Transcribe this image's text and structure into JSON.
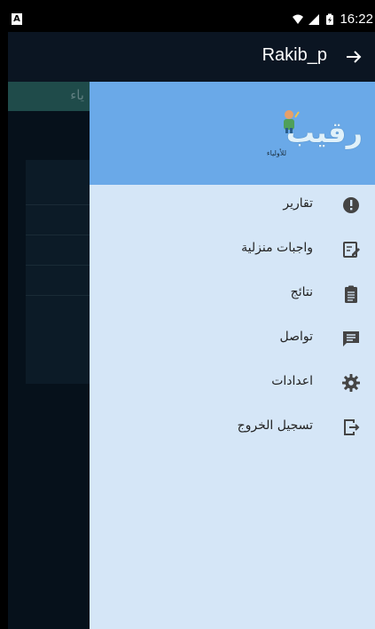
{
  "status_bar": {
    "left_badge": "A",
    "time": "16:22"
  },
  "app_bar": {
    "title": "Rakib_p",
    "arrow_icon": "arrow-right-icon"
  },
  "background_screen": {
    "header_text": "ياء"
  },
  "drawer": {
    "logo": {
      "text": "رقيب",
      "subtitle": "للأولياء"
    },
    "items": [
      {
        "label": "تقارير",
        "icon": "alert-circle-icon"
      },
      {
        "label": "واجبات منزلية",
        "icon": "edit-note-icon"
      },
      {
        "label": "نتائج",
        "icon": "clipboard-icon"
      },
      {
        "label": "تواصل",
        "icon": "chat-icon"
      },
      {
        "label": "اعدادات",
        "icon": "gear-icon"
      },
      {
        "label": "تسجيل الخروج",
        "icon": "logout-icon"
      }
    ]
  },
  "colors": {
    "drawer_bg": "#d5e6f7",
    "drawer_header": "#6aa9e8",
    "app_bar": "#0b1522",
    "icon": "#444444"
  }
}
